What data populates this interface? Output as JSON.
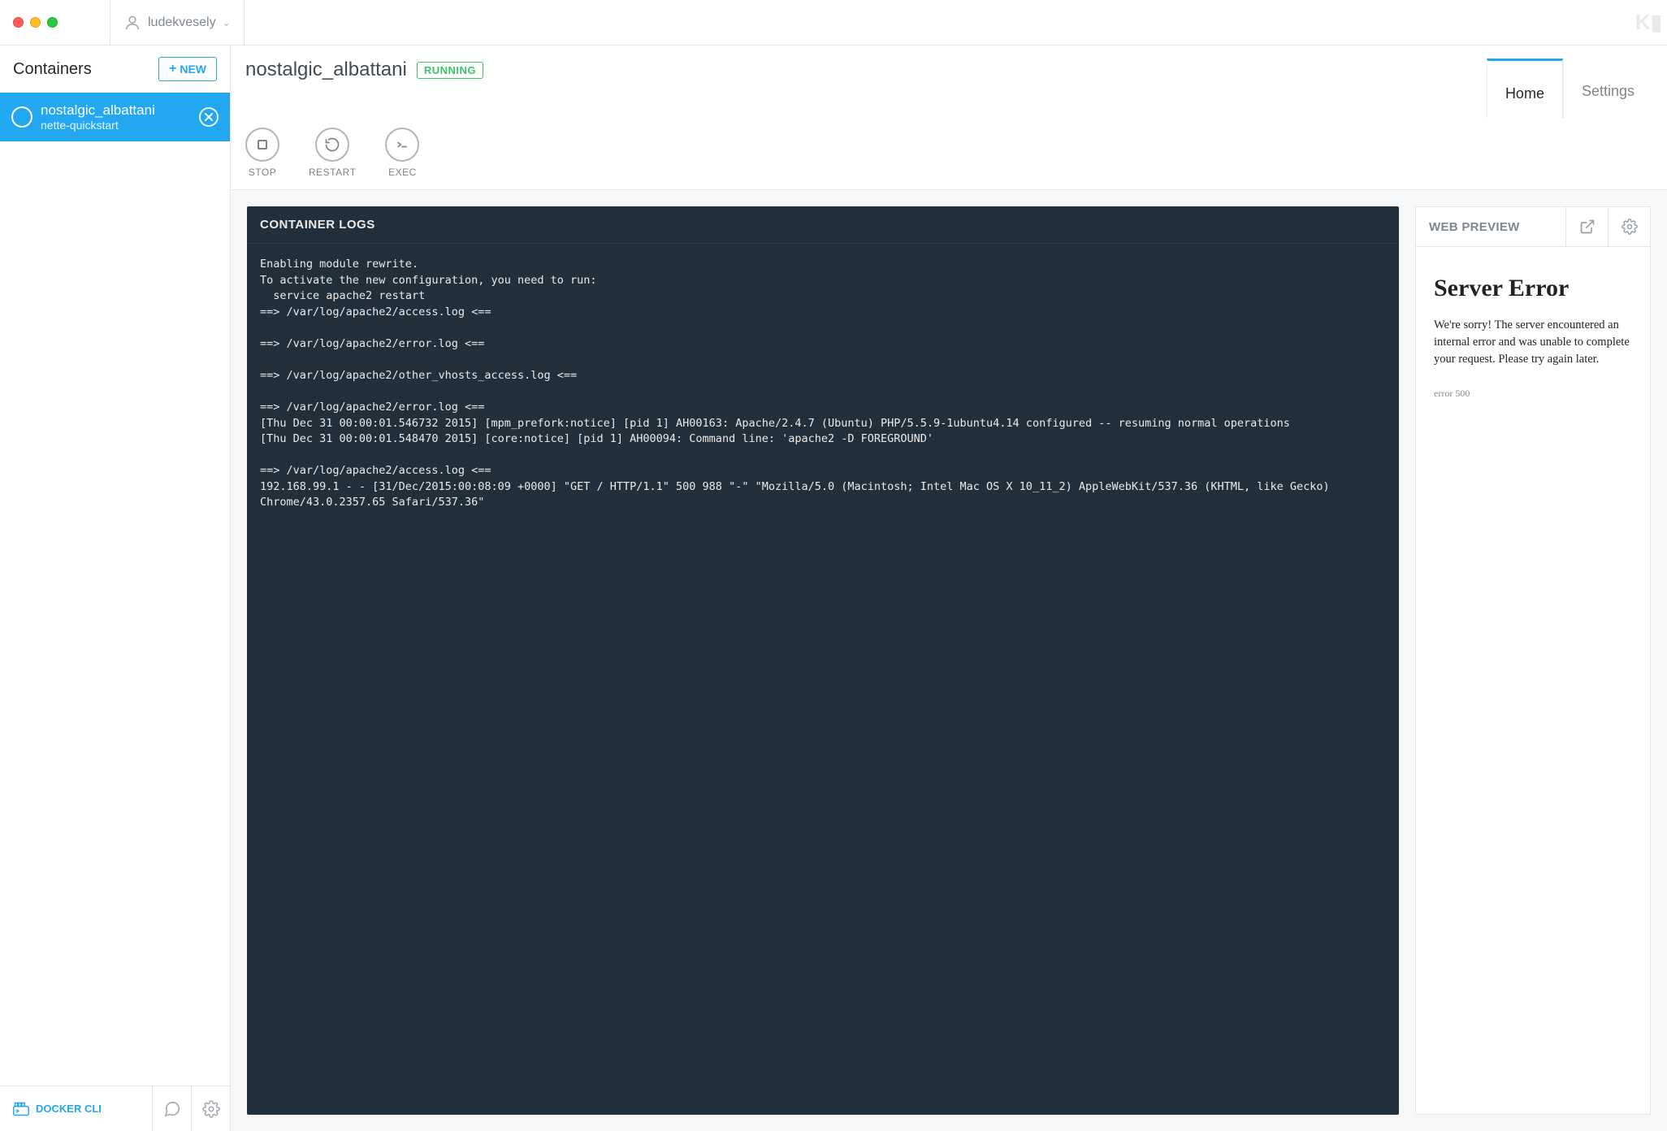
{
  "user": {
    "name": "ludekvesely"
  },
  "sidebar": {
    "title": "Containers",
    "new_label": "NEW",
    "items": [
      {
        "name": "nostalgic_albattani",
        "sub": "nette-quickstart"
      }
    ],
    "footer": {
      "cli_label": "DOCKER CLI"
    }
  },
  "container": {
    "name": "nostalgic_albattani",
    "status_badge": "RUNNING"
  },
  "actions": {
    "stop": "STOP",
    "restart": "RESTART",
    "exec": "EXEC"
  },
  "tabs": {
    "home": "Home",
    "settings": "Settings"
  },
  "logs": {
    "title": "CONTAINER LOGS",
    "text": "Enabling module rewrite.\nTo activate the new configuration, you need to run:\n  service apache2 restart\n==> /var/log/apache2/access.log <==\n\n==> /var/log/apache2/error.log <==\n\n==> /var/log/apache2/other_vhosts_access.log <==\n\n==> /var/log/apache2/error.log <==\n[Thu Dec 31 00:00:01.546732 2015] [mpm_prefork:notice] [pid 1] AH00163: Apache/2.4.7 (Ubuntu) PHP/5.5.9-1ubuntu4.14 configured -- resuming normal operations\n[Thu Dec 31 00:00:01.548470 2015] [core:notice] [pid 1] AH00094: Command line: 'apache2 -D FOREGROUND'\n\n==> /var/log/apache2/access.log <==\n192.168.99.1 - - [31/Dec/2015:00:08:09 +0000] \"GET / HTTP/1.1\" 500 988 \"-\" \"Mozilla/5.0 (Macintosh; Intel Mac OS X 10_11_2) AppleWebKit/537.36 (KHTML, like Gecko) Chrome/43.0.2357.65 Safari/537.36\""
  },
  "preview": {
    "title": "WEB PREVIEW",
    "heading": "Server Error",
    "message": "We're sorry! The server encountered an internal error and was unable to complete your request. Please try again later.",
    "code": "error 500"
  }
}
